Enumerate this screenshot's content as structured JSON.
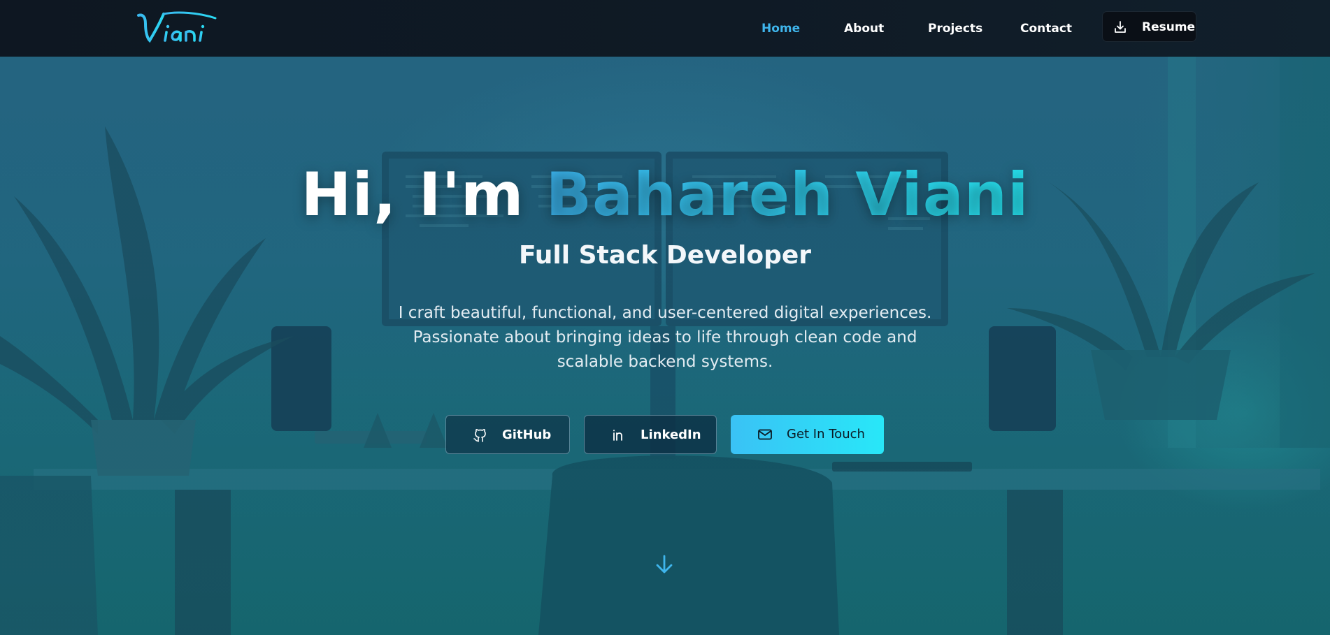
{
  "navbar": {
    "logo_text": "Viani",
    "links": [
      {
        "label": "Home",
        "active": true
      },
      {
        "label": "About",
        "active": false
      },
      {
        "label": "Projects",
        "active": false
      },
      {
        "label": "Contact",
        "active": false
      }
    ],
    "resume_label": "Resume",
    "resume_icon": "download-icon"
  },
  "hero": {
    "greeting": "Hi, I'm ",
    "name": "Bahareh Viani",
    "subtitle": "Full Stack Developer",
    "description": "I craft beautiful, functional, and user-centered digital experiences. Passionate about bringing ideas to life through clean code and scalable backend systems.",
    "buttons": [
      {
        "label": "GitHub",
        "icon": "github-icon"
      },
      {
        "label": "LinkedIn",
        "icon": "linkedin-icon"
      },
      {
        "label": "Get In Touch",
        "icon": "mail-icon"
      }
    ],
    "scroll_icon": "arrow-down-icon"
  },
  "colors": {
    "accent": "#3fb5ec",
    "accent_gradient_end": "#28e7f8",
    "nav_bg": "#0f1a25"
  }
}
